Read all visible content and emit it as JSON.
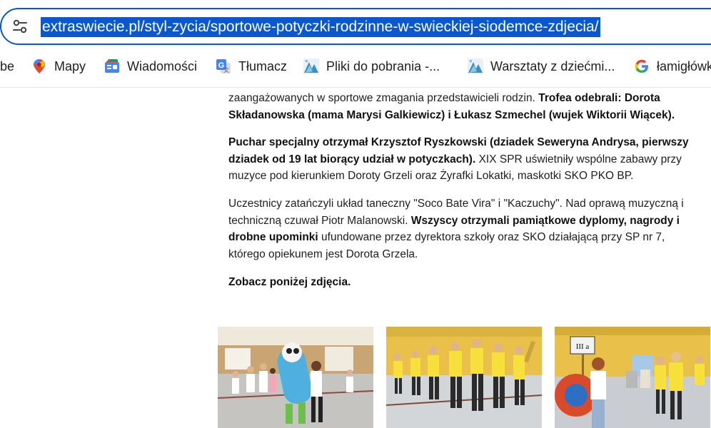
{
  "address_bar": {
    "url": "extraswiecie.pl/styl-zycia/sportowe-potyczki-rodzinne-w-swieckiej-siodemce-zdjecia/"
  },
  "bookmarks": [
    {
      "label": "be",
      "icon": "truncated-bookmark"
    },
    {
      "label": "Mapy",
      "icon": "google-maps-icon"
    },
    {
      "label": "Wiadomości",
      "icon": "google-news-icon"
    },
    {
      "label": "Tłumacz",
      "icon": "google-translate-icon"
    },
    {
      "label": "Pliki do pobrania -...",
      "icon": "site-favicon-icon"
    },
    {
      "label": "Warsztaty z dziećmi...",
      "icon": "site-favicon-icon"
    },
    {
      "label": "łamigłówk",
      "icon": "google-g-icon"
    }
  ],
  "article": {
    "p1": {
      "a": "zaangażowanych w sportowe zmagania przedstawicieli rodzin. ",
      "b": "Trofea odebrali: Dorota Składanowska (mama Marysi Galkiewicz) i Łukasz Szmechel (wujek Wiktorii Wiącek)."
    },
    "p2": {
      "b": "Puchar specjalny otrzymał Krzysztof Ryszkowski (dziadek Seweryna Andrysa, pierwszy dziadek od 19 lat biorący udział w potyczkach).",
      "a": " XIX SPR uświetniły wspólne zabawy przy muzyce pod kierunkiem Doroty Grzeli oraz Żyrafki Lokatki, maskotki SKO PKO BP."
    },
    "p3": {
      "a": "Uczestnicy zatańczyli układ taneczny \"Soco Bate Vira\" i \"Kaczuchy\". Nad oprawą muzyczną i techniczną czuwał Piotr Malanowski. ",
      "b": "Wszyscy otrzymali pamiątkowe dyplomy, nagrody i drobne upominki",
      "c": " ufundowane przez dyrektora szkoły oraz SKO działającą przy SP nr 7, którego opiekunem jest Dorota Grzela."
    },
    "p4": {
      "b": "Zobacz poniżej zdjęcia."
    }
  },
  "gallery": {
    "photo3_sign": "III a"
  },
  "colors": {
    "accent": "#0b57d0",
    "text": "#202020",
    "gym_floor": "#d3d6d9",
    "wall_yellow": "#e8c04a"
  }
}
